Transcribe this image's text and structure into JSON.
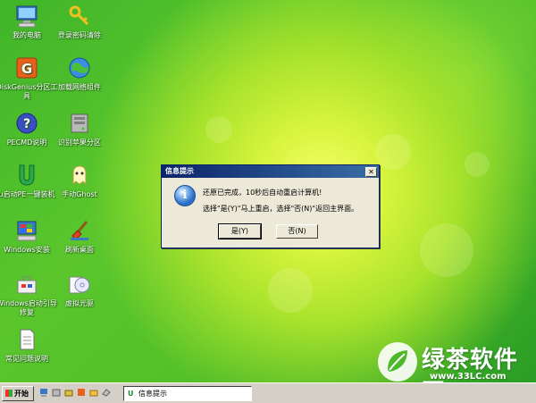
{
  "desktop_icons": [
    {
      "name": "my-computer",
      "label": "我的电脑"
    },
    {
      "name": "login-password-clear",
      "label": "登录密码清除"
    },
    {
      "name": "diskgenius",
      "label": "DiskGenius分区工具"
    },
    {
      "name": "load-network-component",
      "label": "加载网络组件"
    },
    {
      "name": "pecmd-help",
      "label": "PECMD说明"
    },
    {
      "name": "identify-apple-partition",
      "label": "识别苹果分区"
    },
    {
      "name": "u-start-pe-install",
      "label": "u启动PE一键装机"
    },
    {
      "name": "manual-ghost",
      "label": "手动Ghost"
    },
    {
      "name": "windows-install",
      "label": "Windows安装"
    },
    {
      "name": "refresh-desktop",
      "label": "刷新桌面"
    },
    {
      "name": "windows-boot-repair",
      "label": "Windows启动引导修复"
    },
    {
      "name": "virtual-cd",
      "label": "虚拟光驱"
    },
    {
      "name": "faq",
      "label": "常见问题说明"
    }
  ],
  "dialog": {
    "title": "信息提示",
    "close_glyph": "✕",
    "icon_glyph": "i",
    "message_line1": "还原已完成，10秒后自动重启计算机!",
    "message_line2": "选择\"是(Y)\"马上重启，选择\"否(N)\"返回主界面。",
    "yes_label": "是(Y)",
    "no_label": "否(N)"
  },
  "taskbar": {
    "start_label": "开始",
    "task_icon": "U",
    "task_label": "信息提示"
  },
  "watermark": {
    "brand": "绿茶软件园",
    "url": "www.33LC.com"
  },
  "colors": {
    "titlebar": "#0a246a",
    "dialog_bg": "#ece9d8",
    "taskbar_bg": "#d4d0c8"
  }
}
